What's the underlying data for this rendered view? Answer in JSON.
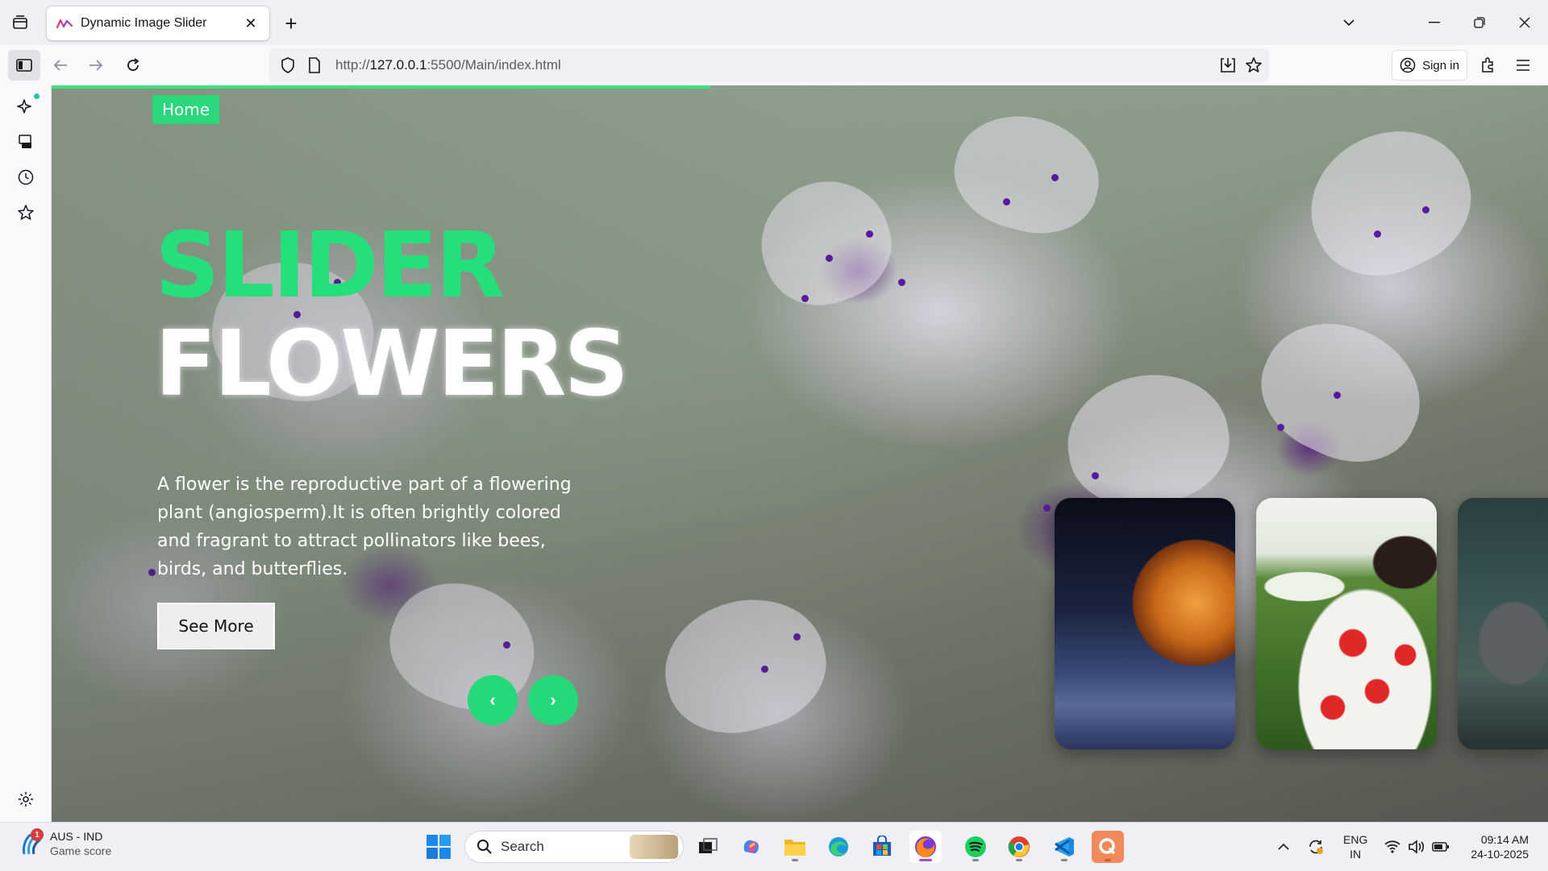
{
  "browser": {
    "tab_title": "Dynamic Image Slider",
    "url_prefix": "http://",
    "url_host": "127.0.0.1",
    "url_rest": ":5500/Main/index.html",
    "signin_label": "Sign in"
  },
  "page": {
    "nav_home": "Home",
    "title_line1": "SLIDER",
    "title_line2": "FLOWERS",
    "description": "A flower is the reproductive part of a flowering plant (angiosperm).It is often brightly colored and fragrant to attract pollinators like bees, birds, and butterflies.",
    "see_more": "See More",
    "prev_symbol": "‹",
    "next_symbol": "›",
    "progress_fraction": 0.44,
    "thumbnails": [
      "frozen-bubble",
      "puppy-in-cup",
      "elephant"
    ],
    "colors": {
      "accent": "#25e07a",
      "title_secondary": "#ffffff"
    }
  },
  "taskbar": {
    "weather_title": "AUS - IND",
    "weather_sub": "Game score",
    "weather_badge": "1",
    "search_label": "Search",
    "lang_line1": "ENG",
    "lang_line2": "IN",
    "time": "09:14 AM",
    "date": "24-10-2025"
  }
}
